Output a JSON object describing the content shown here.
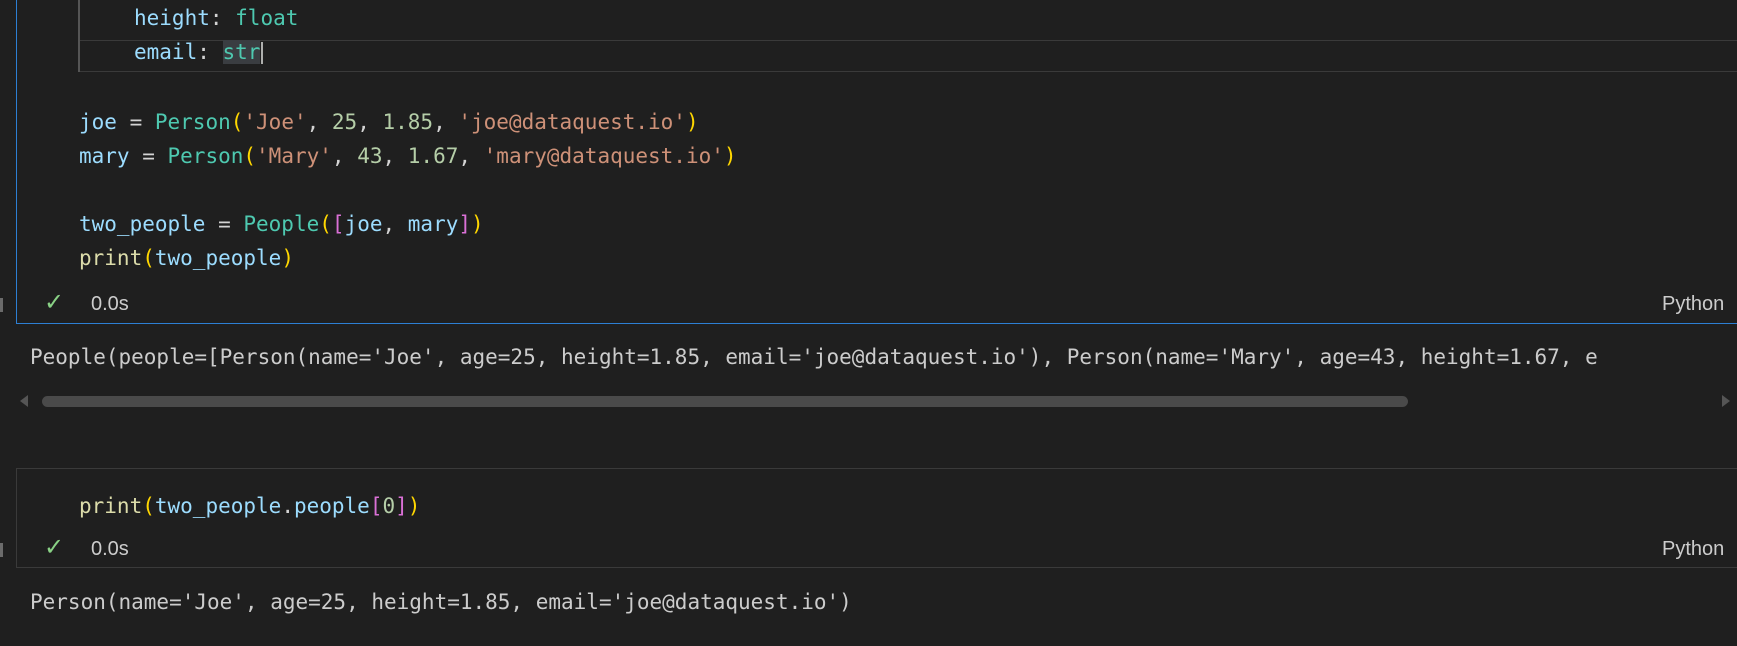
{
  "cell1": {
    "lines": {
      "height_line": {
        "key": "height",
        "colon": ": ",
        "type": "float"
      },
      "email_line": {
        "key": "email",
        "colon": ": ",
        "type": "str"
      },
      "joe_line": {
        "var": "joe",
        "eq": " = ",
        "cls": "Person",
        "lp": "(",
        "s1": "'Joe'",
        "c1": ", ",
        "n1": "25",
        "c2": ", ",
        "n2": "1.85",
        "c3": ", ",
        "s2": "'joe@dataquest.io'",
        "rp": ")"
      },
      "mary_line": {
        "var": "mary",
        "eq": " = ",
        "cls": "Person",
        "lp": "(",
        "s1": "'Mary'",
        "c1": ", ",
        "n1": "43",
        "c2": ", ",
        "n2": "1.67",
        "c3": ", ",
        "s2": "'mary@dataquest.io'",
        "rp": ")"
      },
      "two_line": {
        "var": "two_people",
        "eq": " = ",
        "cls": "People",
        "lp": "(",
        "lb": "[",
        "a": "joe",
        "c": ", ",
        "b": "mary",
        "rb": "]",
        "rp": ")"
      },
      "print_line": {
        "fn": "print",
        "lp": "(",
        "arg": "two_people",
        "rp": ")"
      }
    },
    "status_check": "✓",
    "status_time": "0.0s",
    "language": "Python",
    "output": "People(people=[Person(name='Joe', age=25, height=1.85, email='joe@dataquest.io'), Person(name='Mary', age=43, height=1.67, e"
  },
  "cell2": {
    "print_line": {
      "fn": "print",
      "lp": "(",
      "obj": "two_people",
      "dot": ".",
      "attr": "people",
      "lb": "[",
      "idx": "0",
      "rb": "]",
      "rp": ")"
    },
    "status_check": "✓",
    "status_time": "0.0s",
    "language": "Python",
    "output": "Person(name='Joe', age=25, height=1.85, email='joe@dataquest.io')"
  },
  "colors": {
    "accent": "#2d7fd3",
    "check": "#89d185",
    "background": "#1f1f1f"
  }
}
